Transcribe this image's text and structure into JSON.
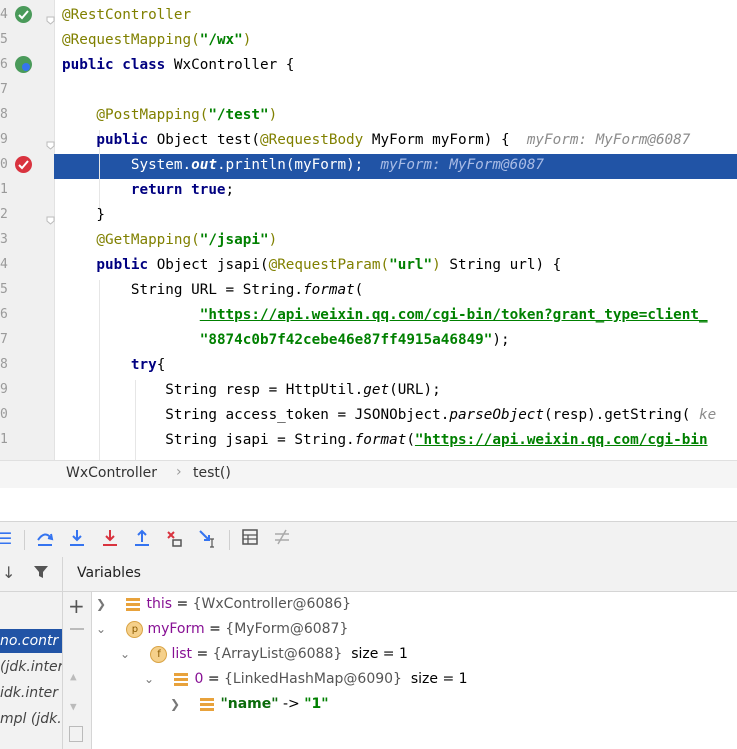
{
  "editor": {
    "line_numbers": [
      "4",
      "5",
      "6",
      "7",
      "8",
      "9",
      "0",
      "1",
      "2",
      "3",
      "4",
      "5",
      "6",
      "7",
      "8",
      "9",
      "0",
      "1"
    ],
    "lines": [
      [
        {
          "t": "@RestController",
          "c": "an"
        }
      ],
      [
        {
          "t": "@RequestMapping(",
          "c": "an"
        },
        {
          "t": "\"/wx\"",
          "c": "st"
        },
        {
          "t": ")",
          "c": "an"
        }
      ],
      [
        {
          "t": "public class ",
          "c": "kw"
        },
        {
          "t": "WxController {",
          "c": ""
        }
      ],
      [],
      [
        {
          "t": "    @PostMapping(",
          "c": "an"
        },
        {
          "t": "\"/test\"",
          "c": "st"
        },
        {
          "t": ")",
          "c": "an"
        }
      ],
      [
        {
          "t": "    public ",
          "c": "kw"
        },
        {
          "t": "Object test(",
          "c": ""
        },
        {
          "t": "@RequestBody ",
          "c": "an"
        },
        {
          "t": "MyForm myForm) {  ",
          "c": ""
        },
        {
          "t": "myForm: MyForm@6087",
          "c": "hint"
        }
      ],
      [
        {
          "t": "        System.",
          "c": ""
        },
        {
          "t": "out",
          "c": "itb"
        },
        {
          "t": ".println(myForm);  ",
          "c": ""
        },
        {
          "t": "myForm: MyForm@6087",
          "c": "hint"
        }
      ],
      [
        {
          "t": "        return true",
          "c": "kw"
        },
        {
          "t": ";",
          "c": ""
        }
      ],
      [
        {
          "t": "    }",
          "c": ""
        }
      ],
      [
        {
          "t": "    @GetMapping(",
          "c": "an"
        },
        {
          "t": "\"/jsapi\"",
          "c": "st"
        },
        {
          "t": ")",
          "c": "an"
        }
      ],
      [
        {
          "t": "    public ",
          "c": "kw"
        },
        {
          "t": "Object jsapi(",
          "c": ""
        },
        {
          "t": "@RequestParam(",
          "c": "an"
        },
        {
          "t": "\"url\"",
          "c": "st"
        },
        {
          "t": ") ",
          "c": "an"
        },
        {
          "t": "String url) {",
          "c": ""
        }
      ],
      [
        {
          "t": "        String URL = String.",
          "c": ""
        },
        {
          "t": "format",
          "c": "it"
        },
        {
          "t": "(",
          "c": ""
        }
      ],
      [
        {
          "t": "                ",
          "c": ""
        },
        {
          "t": "\"https://api.weixin.qq.com/cgi-bin/token?grant_type=client_",
          "c": "stu"
        }
      ],
      [
        {
          "t": "                ",
          "c": ""
        },
        {
          "t": "\"8874c0b7f42cebe46e87ff4915a46849\"",
          "c": "st"
        },
        {
          "t": ");",
          "c": ""
        }
      ],
      [
        {
          "t": "        try",
          "c": "kw"
        },
        {
          "t": "{",
          "c": ""
        }
      ],
      [
        {
          "t": "            String resp = HttpUtil.",
          "c": ""
        },
        {
          "t": "get",
          "c": "it"
        },
        {
          "t": "(URL);",
          "c": ""
        }
      ],
      [
        {
          "t": "            String access_token = JSONObject.",
          "c": ""
        },
        {
          "t": "parseObject",
          "c": "it"
        },
        {
          "t": "(resp).getString( ",
          "c": ""
        },
        {
          "t": "ke",
          "c": "hint"
        }
      ],
      [
        {
          "t": "            String jsapi = String.",
          "c": ""
        },
        {
          "t": "format",
          "c": "it"
        },
        {
          "t": "(",
          "c": ""
        },
        {
          "t": "\"https://api.weixin.qq.com/cgi-bin",
          "c": "stu"
        }
      ]
    ]
  },
  "breadcrumb": {
    "class_name": "WxController",
    "separator": "›",
    "method": "test()"
  },
  "toolbar": {
    "icons": [
      "menu-icon",
      "step-over-icon",
      "step-into-icon",
      "force-step-into-icon",
      "step-out-icon",
      "drop-frame-icon",
      "run-to-cursor-icon",
      "evaluate-icon",
      "trace-icon"
    ]
  },
  "frames": {
    "items": [
      "no.contr",
      "(jdk.inter",
      "idk.inter",
      "mpl (jdk.r"
    ]
  },
  "variables": {
    "title": "Variables",
    "rows": [
      {
        "name": "this",
        "eq": " = ",
        "value": "{WxController@6086}",
        "extra": ""
      },
      {
        "name": "myForm",
        "eq": " = ",
        "value": "{MyForm@6087}",
        "extra": ""
      },
      {
        "name": "list",
        "eq": " = ",
        "value": "{ArrayList@6088}",
        "extra": "size = 1"
      },
      {
        "name": "0",
        "eq": " = ",
        "value": "{LinkedHashMap@6090}",
        "extra": "size = 1"
      },
      {
        "name": "\"name\"",
        "eq": " -> ",
        "value": "\"1\"",
        "extra": ""
      }
    ]
  },
  "colors": {
    "selected_line": "#2154a6",
    "accent": "#3574f0"
  }
}
